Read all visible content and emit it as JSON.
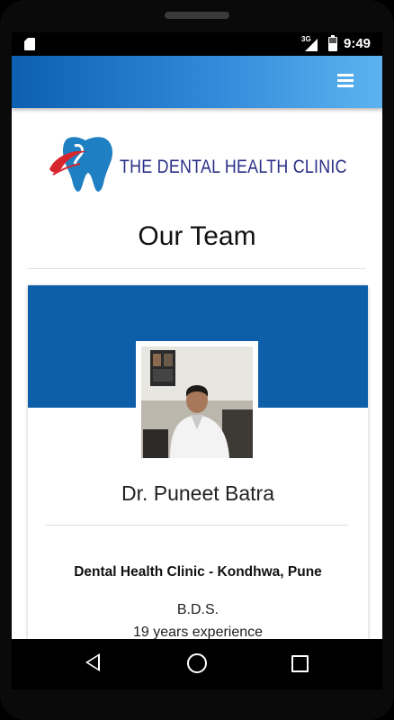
{
  "status_bar": {
    "time": "9:49",
    "network": "3G",
    "icons": [
      "sd-card-icon",
      "signal-icon",
      "battery-icon"
    ]
  },
  "app_bar": {
    "menu_icon": "menu-icon",
    "color_start": "#0e5fb0",
    "color_end": "#5db3ef"
  },
  "logo": {
    "text": "THE DENTAL HEALTH CLINIC"
  },
  "section": {
    "title": "Our Team"
  },
  "team": [
    {
      "name": "Dr. Puneet Batra",
      "clinic": "Dental Health Clinic - Kondhwa, Pune",
      "degree": "B.D.S.",
      "experience": "19 years experience"
    }
  ],
  "colors": {
    "banner": "#0e5fa9",
    "logo_text": "#2a2f86",
    "logo_tooth": "#1e7fc2",
    "logo_swoosh": "#d7262e"
  },
  "nav_bar": {
    "icons": [
      "back-icon",
      "home-icon",
      "recents-icon"
    ]
  }
}
